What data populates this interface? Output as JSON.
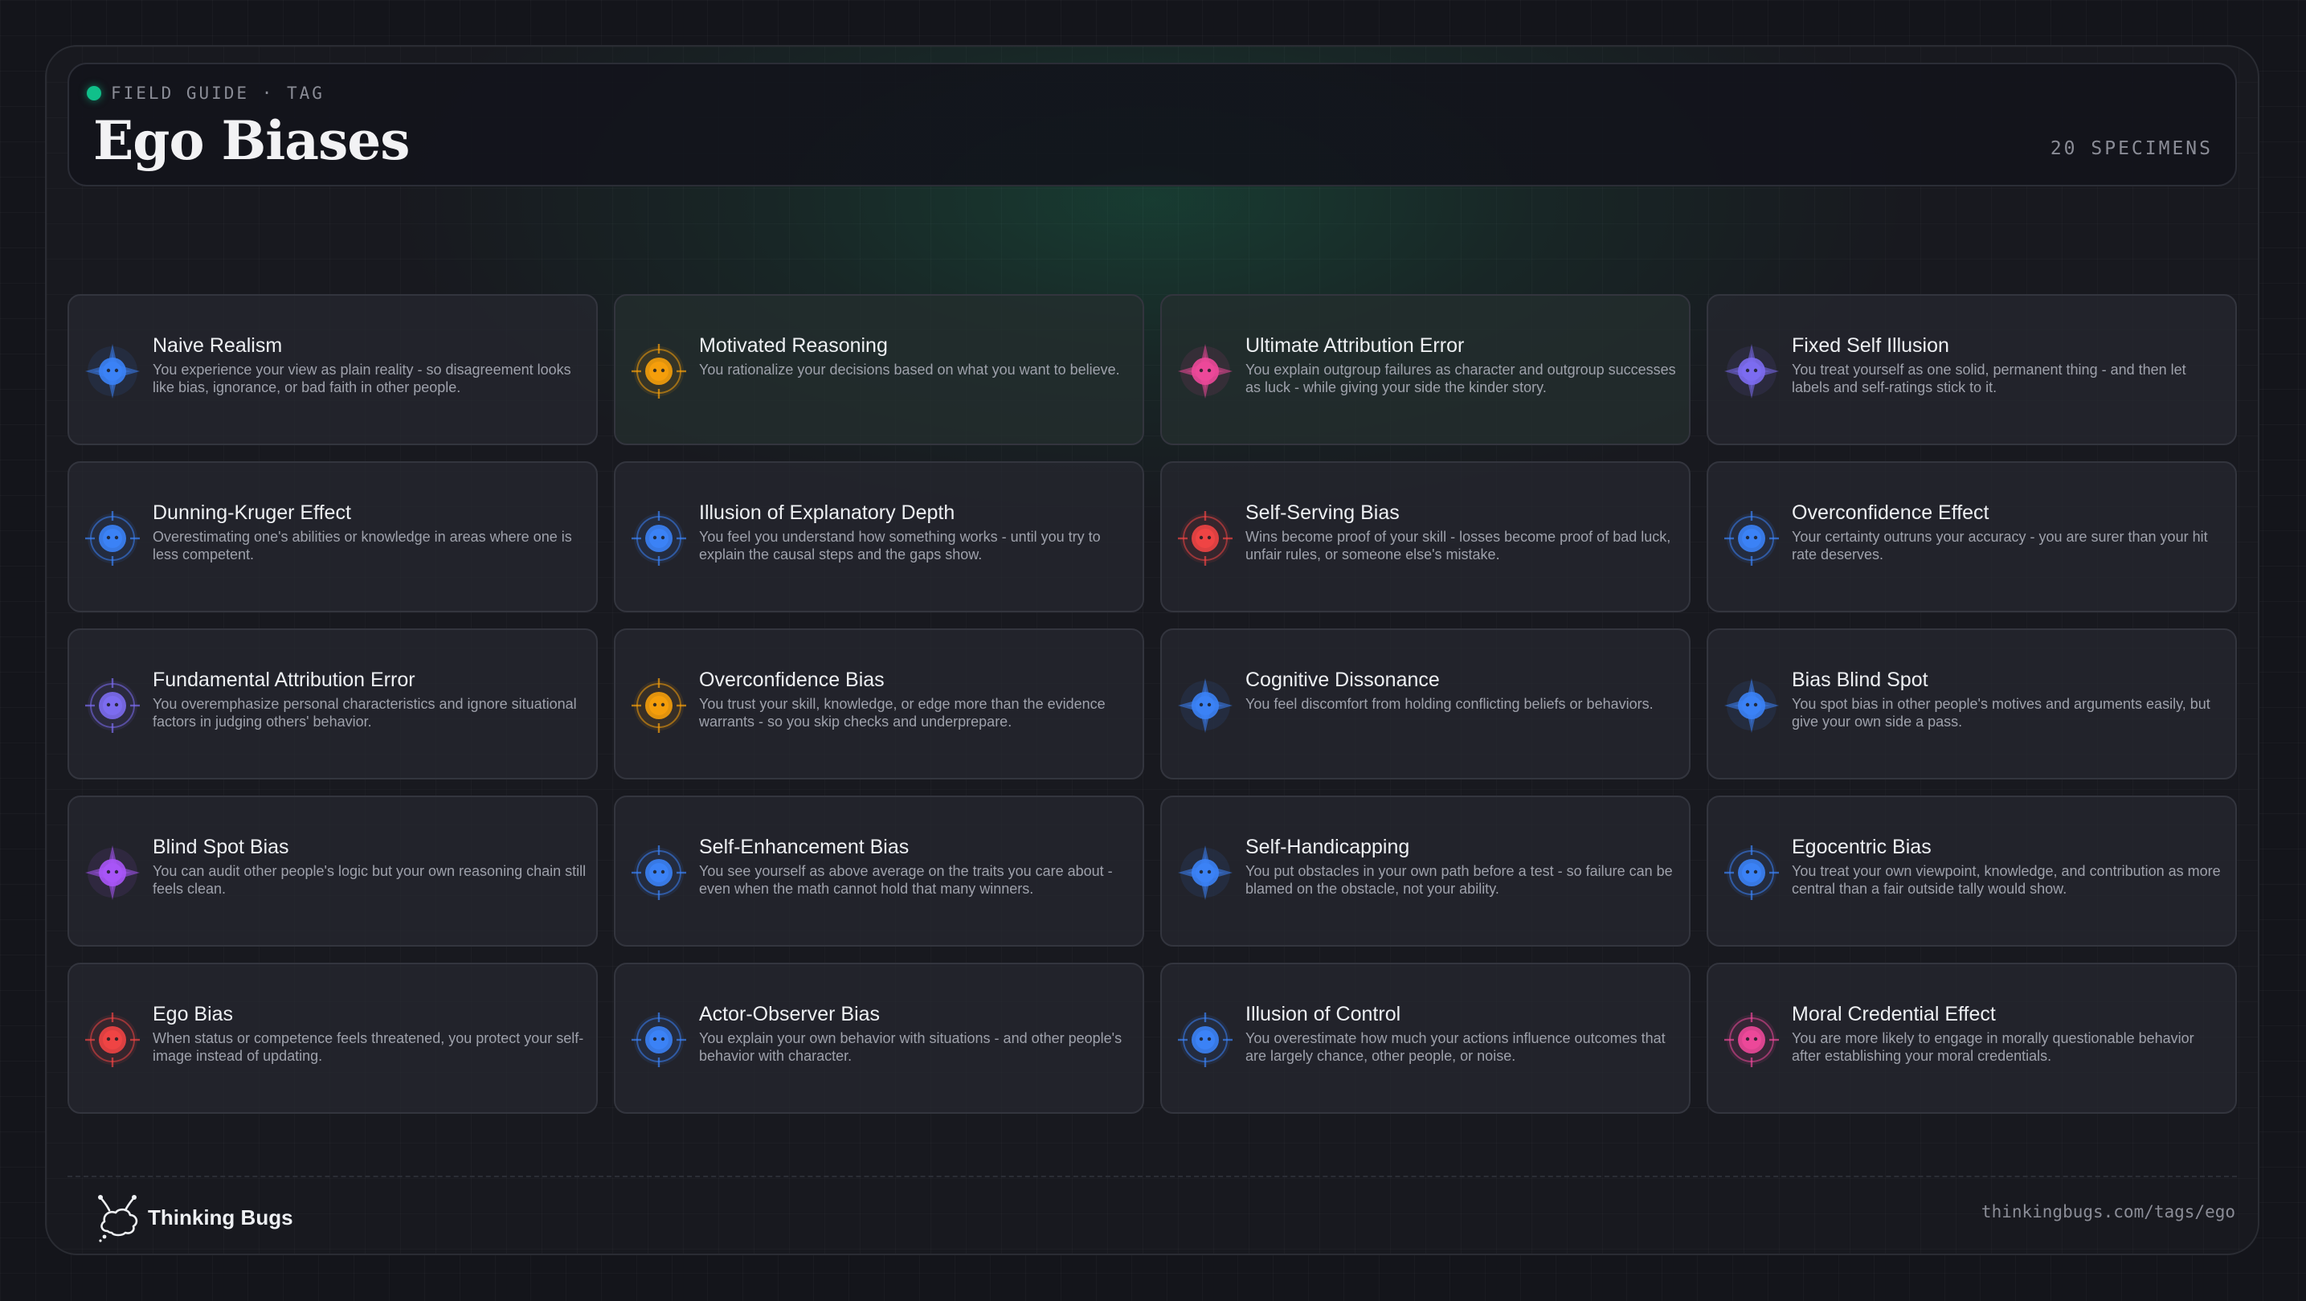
{
  "header": {
    "eyebrow": "FIELD GUIDE · TAG",
    "title": "Ego Biases",
    "count": "20 SPECIMENS"
  },
  "colors": {
    "accent": "#10c08a",
    "blue": "#3b82f6",
    "amber": "#f59e0b",
    "pink": "#ec4899",
    "violet": "#7c6cf0",
    "red": "#ef4444",
    "purple": "#a855f7"
  },
  "cards": [
    {
      "title": "Naive Realism",
      "desc": "You experience your view as plain reality - so disagreement looks like bias, ignorance, or bad faith in other people.",
      "color": "#3b82f6",
      "shape": "star",
      "icon": "bug-icon",
      "tint": false
    },
    {
      "title": "Motivated Reasoning",
      "desc": "You rationalize your decisions based on what you want to believe.",
      "color": "#f59e0b",
      "shape": "target",
      "icon": "bug-icon",
      "tint": true
    },
    {
      "title": "Ultimate Attribution Error",
      "desc": "You explain outgroup failures as character and outgroup successes as luck - while giving your side the kinder story.",
      "color": "#ec4899",
      "shape": "star",
      "icon": "bug-icon",
      "tint": true
    },
    {
      "title": "Fixed Self Illusion",
      "desc": "You treat yourself as one solid, permanent thing - and then let labels and self-ratings stick to it.",
      "color": "#7c6cf0",
      "shape": "star",
      "icon": "bug-icon",
      "tint": false
    },
    {
      "title": "Dunning-Kruger Effect",
      "desc": "Overestimating one's abilities or knowledge in areas where one is less competent.",
      "color": "#3b82f6",
      "shape": "target",
      "icon": "bug-icon",
      "tint": false
    },
    {
      "title": "Illusion of Explanatory Depth",
      "desc": "You feel you understand how something works - until you try to explain the causal steps and the gaps show.",
      "color": "#3b82f6",
      "shape": "target",
      "icon": "bug-icon",
      "tint": false
    },
    {
      "title": "Self-Serving Bias",
      "desc": "Wins become proof of your skill - losses become proof of bad luck, unfair rules, or someone else's mistake.",
      "color": "#ef4444",
      "shape": "target",
      "icon": "bug-icon",
      "tint": false
    },
    {
      "title": "Overconfidence Effect",
      "desc": "Your certainty outruns your accuracy - you are surer than your hit rate deserves.",
      "color": "#3b82f6",
      "shape": "target",
      "icon": "bug-icon",
      "tint": false
    },
    {
      "title": "Fundamental Attribution Error",
      "desc": "You overemphasize personal characteristics and ignore situational factors in judging others' behavior.",
      "color": "#7c6cf0",
      "shape": "target",
      "icon": "bug-icon",
      "tint": false
    },
    {
      "title": "Overconfidence Bias",
      "desc": "You trust your skill, knowledge, or edge more than the evidence warrants - so you skip checks and underprepare.",
      "color": "#f59e0b",
      "shape": "target",
      "icon": "bug-icon",
      "tint": false
    },
    {
      "title": "Cognitive Dissonance",
      "desc": "You feel discomfort from holding conflicting beliefs or behaviors.",
      "color": "#3b82f6",
      "shape": "star",
      "icon": "bug-icon",
      "tint": false
    },
    {
      "title": "Bias Blind Spot",
      "desc": "You spot bias in other people's motives and arguments easily, but give your own side a pass.",
      "color": "#3b82f6",
      "shape": "star",
      "icon": "bug-icon",
      "tint": false
    },
    {
      "title": "Blind Spot Bias",
      "desc": "You can audit other people's logic but your own reasoning chain still feels clean.",
      "color": "#a855f7",
      "shape": "star",
      "icon": "bug-icon",
      "tint": false
    },
    {
      "title": "Self-Enhancement Bias",
      "desc": "You see yourself as above average on the traits you care about - even when the math cannot hold that many winners.",
      "color": "#3b82f6",
      "shape": "target",
      "icon": "bug-icon",
      "tint": false
    },
    {
      "title": "Self-Handicapping",
      "desc": "You put obstacles in your own path before a test - so failure can be blamed on the obstacle, not your ability.",
      "color": "#3b82f6",
      "shape": "star",
      "icon": "bug-icon",
      "tint": false
    },
    {
      "title": "Egocentric Bias",
      "desc": "You treat your own viewpoint, knowledge, and contribution as more central than a fair outside tally would show.",
      "color": "#3b82f6",
      "shape": "target",
      "icon": "bug-icon",
      "tint": false
    },
    {
      "title": "Ego Bias",
      "desc": "When status or competence feels threatened, you protect your self-image instead of updating.",
      "color": "#ef4444",
      "shape": "target",
      "icon": "bug-icon",
      "tint": false
    },
    {
      "title": "Actor-Observer Bias",
      "desc": "You explain your own behavior with situations - and other people's behavior with character.",
      "color": "#3b82f6",
      "shape": "target",
      "icon": "bug-icon",
      "tint": false
    },
    {
      "title": "Illusion of Control",
      "desc": "You overestimate how much your actions influence outcomes that are largely chance, other people, or noise.",
      "color": "#3b82f6",
      "shape": "target",
      "icon": "bug-icon",
      "tint": false
    },
    {
      "title": "Moral Credential Effect",
      "desc": "You are more likely to engage in morally questionable behavior after establishing your moral credentials.",
      "color": "#ec4899",
      "shape": "target",
      "icon": "bug-icon",
      "tint": false
    }
  ],
  "footer": {
    "brand": "Thinking Bugs",
    "brand_icon": "thinking-bugs-logo-icon",
    "url": "thinkingbugs.com/tags/ego"
  }
}
